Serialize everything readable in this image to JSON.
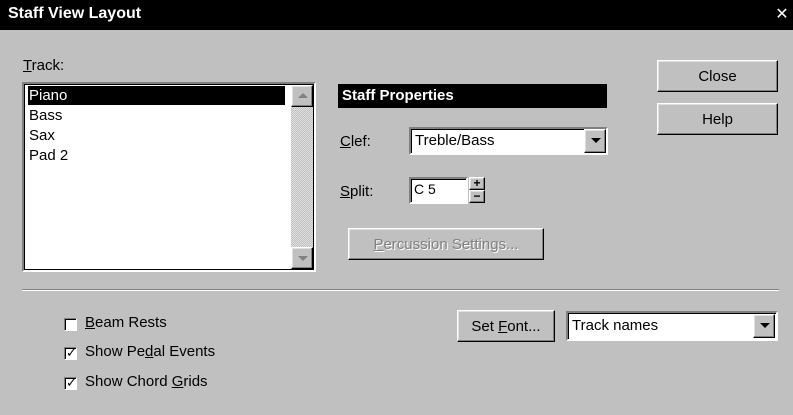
{
  "window": {
    "title": "Staff View Layout",
    "close_glyph": "✕"
  },
  "track": {
    "label_mnemonic": "T",
    "label_rest": "rack:",
    "items": [
      "Piano",
      "Bass",
      "Sax",
      "Pad 2"
    ],
    "selected_index": 0
  },
  "staff_properties": {
    "header": "Staff Properties",
    "clef_label_mnemonic": "C",
    "clef_label_rest": "lef:",
    "clef_value": "Treble/Bass",
    "split_label_mnemonic": "S",
    "split_label_rest": "plit:",
    "split_value": "C 5",
    "percussion_mnemonic": "P",
    "percussion_rest": "ercussion Settings..."
  },
  "buttons": {
    "close": "Close",
    "help": "Help",
    "set_font_prefix": "Set ",
    "set_font_mnemonic": "F",
    "set_font_rest": "ont..."
  },
  "font_target": {
    "value": "Track names"
  },
  "options": {
    "beam_rests": {
      "mnemonic": "B",
      "rest": "eam Rests",
      "checked": false
    },
    "pedal_events": {
      "prefix": "Show Pe",
      "mnemonic": "d",
      "rest": "al Events",
      "checked": true
    },
    "chord_grids": {
      "prefix": "Show Chord ",
      "mnemonic": "G",
      "rest": "rids",
      "checked": true
    }
  },
  "colors": {
    "face": "#c0c0c0",
    "title_bg": "#000000",
    "selection_bg": "#000000",
    "disabled_text": "#808080"
  }
}
